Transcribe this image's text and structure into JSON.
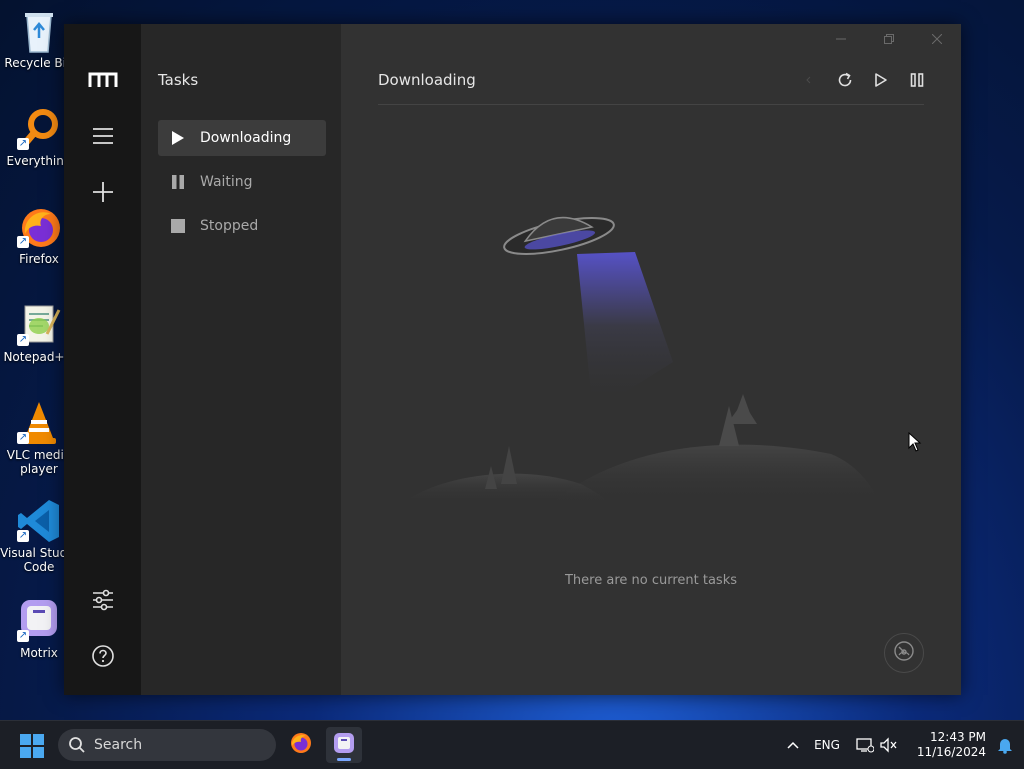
{
  "desktop": {
    "icons": [
      {
        "label": "Recycle Bin",
        "icon": "recycle-bin-icon"
      },
      {
        "label": "Everything",
        "icon": "everything-search-icon"
      },
      {
        "label": "Firefox",
        "icon": "firefox-icon"
      },
      {
        "label": "Notepad++",
        "icon": "notepadpp-icon"
      },
      {
        "label": "VLC media player",
        "icon": "vlc-icon"
      },
      {
        "label": "Visual Studio Code",
        "icon": "vscode-icon"
      },
      {
        "label": "Motrix",
        "icon": "motrix-icon"
      }
    ]
  },
  "app": {
    "rail": {
      "logo": "motrix-logo-icon",
      "menu": "menu-icon",
      "add": "plus-icon",
      "preferences": "sliders-icon",
      "help": "help-icon"
    },
    "panel": {
      "title": "Tasks",
      "items": [
        {
          "label": "Downloading",
          "icon": "play-icon",
          "active": true
        },
        {
          "label": "Waiting",
          "icon": "pause-icon",
          "active": false
        },
        {
          "label": "Stopped",
          "icon": "stop-icon",
          "active": false
        }
      ]
    },
    "main": {
      "title": "Downloading",
      "actions": [
        "clear-icon",
        "refresh-icon",
        "resume-all-icon",
        "pause-all-icon"
      ],
      "empty_text": "There are no current tasks",
      "speedometer": "speedometer-icon"
    },
    "window_controls": [
      "minimize-icon",
      "maximize-icon",
      "close-icon"
    ]
  },
  "taskbar": {
    "search_placeholder": "Search",
    "language": "ENG",
    "time": "12:43 PM",
    "date": "11/16/2024"
  },
  "colors": {
    "rail_bg": "#171717",
    "panel_bg": "#272727",
    "main_bg": "#323232",
    "active_item_bg": "#3c3c3c",
    "accent_beam": "#5a55d6"
  }
}
